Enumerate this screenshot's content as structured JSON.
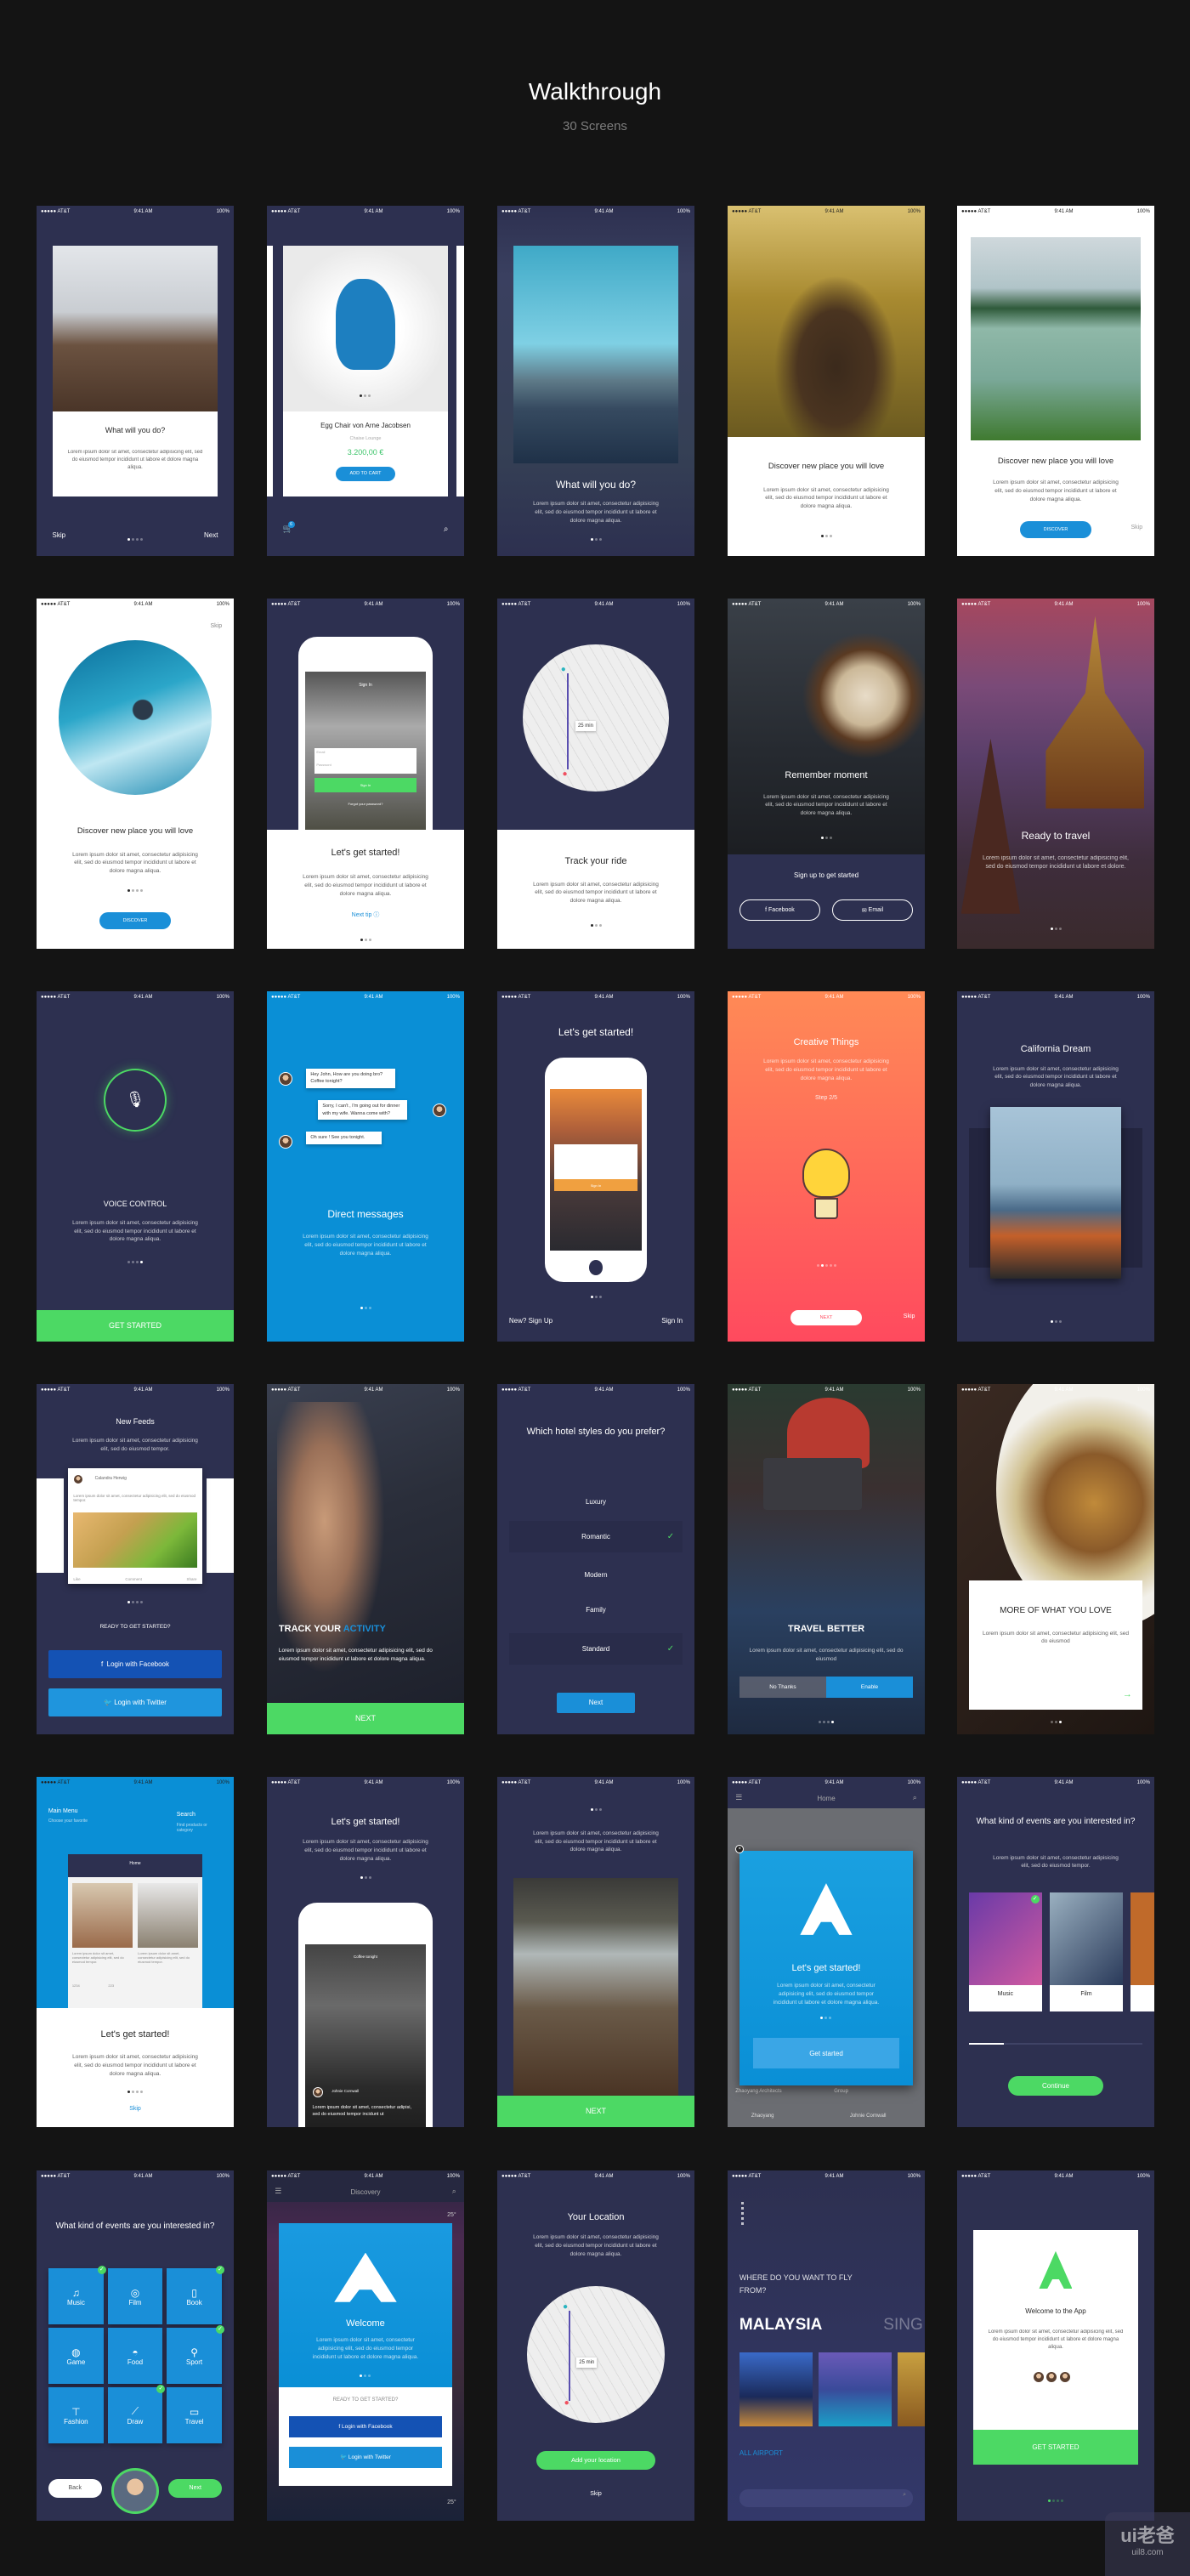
{
  "header": {
    "title": "Walkthrough",
    "subtitle": "30 Screens"
  },
  "status": {
    "carrier": "●●●●● AT&T",
    "time": "9:41 AM",
    "battery": "100%"
  },
  "lorem": {
    "long": "Lorem ipsum dolor sit amet, consectetur adipisicing elit, sed do eiusmod tempor incididunt ut labore et dolore magna aliqua.",
    "short": "Lorem ipsum dolor sit amet, consectetur adipisicing elit, sed do eiusmod tempor.",
    "travel": "Lorem ipsum dolor sit amet, consectetur adipisicing elit, sed do eiusmod tempor incididunt ut labore et dolore.",
    "mid": "Lorem ipsum dolor sit amet, consectetur adipisicing elit, sed do eiusmod"
  },
  "colors": {
    "navy": "#2d3050",
    "blue": "#1a8fd8",
    "green": "#4cd964",
    "facebook": "#1452b4",
    "twitter": "#1f95dd",
    "orange": "#ff8a56",
    "pink": "#ff4a5e"
  },
  "s1": {
    "title": "What will you do?",
    "skip": "Skip",
    "next": "Next"
  },
  "s2": {
    "title": "Egg Chair von Arne Jacobsen",
    "subtitle": "Chaise Lounge",
    "price": "3.200,00 €",
    "button": "ADD TO CART",
    "cart_badge": "6"
  },
  "s3": {
    "title": "What will you do?"
  },
  "s4": {
    "title": "Discover new place you will love"
  },
  "s5": {
    "title": "Discover new place you will love",
    "button": "DISCOVER",
    "skip": "Skip"
  },
  "s6": {
    "skip": "Skip",
    "title": "Discover new place you will love",
    "button": "DISCOVER"
  },
  "s7": {
    "title": "Let's get started!",
    "next_tip": "Next tip ⓘ",
    "mock_header": "Sign In",
    "email": "Email",
    "password": "Password",
    "signin": "Sign In",
    "forgot": "Forgot your password?"
  },
  "s8": {
    "title": "Track your ride",
    "eta": "25 min"
  },
  "s9": {
    "title": "Remember moment",
    "signup": "Sign up to get started",
    "facebook": "Facebook",
    "email": "Email"
  },
  "s10": {
    "title": "Ready to travel"
  },
  "s11": {
    "title": "VOICE CONTROL",
    "button": "GET STARTED"
  },
  "s12": {
    "title": "Direct messages",
    "msg1": "Hey John, How are you doing bro? Coffee tonight?",
    "msg2": "Sorry, I can't , I'm going out for dinner with my wife. Wanna come with?",
    "msg3": "Oh sure ! See you tonight."
  },
  "s13": {
    "title": "Let's get started!",
    "signup": "New? Sign Up",
    "signin": "Sign In",
    "mock_button": "Sign In"
  },
  "s14": {
    "title": "Creative Things",
    "step": "Step 2/5",
    "button": "NEXT",
    "skip": "Skip"
  },
  "s15": {
    "title": "California Dream"
  },
  "s16": {
    "title": "New Feeds",
    "feed_user": "Calandra Herwig",
    "like": "Like",
    "comment": "Comment",
    "share": "Share",
    "ready": "READY TO GET STARTED?",
    "facebook": "Login with Facebook",
    "twitter": "Login with Twitter"
  },
  "s17": {
    "title_a": "TRACK YOUR ",
    "title_b": "ACTIVITY",
    "button": "NEXT"
  },
  "s18": {
    "title": "Which hotel styles do you prefer?",
    "options": [
      {
        "label": "Luxury",
        "selected": false
      },
      {
        "label": "Romantic",
        "selected": true
      },
      {
        "label": "Modern",
        "selected": false
      },
      {
        "label": "Family",
        "selected": false
      },
      {
        "label": "Standard",
        "selected": true
      }
    ],
    "check": "✓",
    "button": "Next"
  },
  "s19": {
    "title": "TRAVEL BETTER",
    "no": "No Thanks",
    "yes": "Enable"
  },
  "s20": {
    "title": "MORE OF WHAT YOU LOVE",
    "arrow": "→"
  },
  "s21": {
    "menu_title": "Main Menu",
    "menu_sub": "Choose your favorite",
    "search_title": "Search",
    "search_sub": "Find products or category",
    "mock_header": "Home",
    "likes": "1234",
    "comments": "223",
    "title": "Let's get started!",
    "skip": "Skip"
  },
  "s22": {
    "title": "Let's get started!",
    "mock_header": "Coffee tonight",
    "user": "Johnie Cornwall",
    "post": "Lorem ipsum dolor sit amet, consectetur adipisi, sed do eiusmod tempor incidunt ut"
  },
  "s23": {
    "button": "NEXT"
  },
  "s24": {
    "header": "Home",
    "title": "Let's get started!",
    "button": "Get started",
    "bg_item1": "Zhaoyang Architects",
    "bg_item2": "Group",
    "bg_user1": "Zhaoyang",
    "bg_user2": "Johnie Cornwall"
  },
  "s25": {
    "title": "What kind of events are you interested in?",
    "cat1": "Music",
    "cat2": "Film",
    "button": "Continue",
    "progress": 0.2
  },
  "s26": {
    "title": "What kind of events are you interested in?",
    "tiles": [
      {
        "label": "Music",
        "icon": "♫",
        "checked": true
      },
      {
        "label": "Film",
        "icon": "◎",
        "checked": false
      },
      {
        "label": "Book",
        "icon": "▯",
        "checked": true
      },
      {
        "label": "Game",
        "icon": "◍",
        "checked": false
      },
      {
        "label": "Food",
        "icon": "◓",
        "checked": false
      },
      {
        "label": "Sport",
        "icon": "⚲",
        "checked": true
      },
      {
        "label": "Fashion",
        "icon": "⊤",
        "checked": false
      },
      {
        "label": "Draw",
        "icon": "⟋",
        "checked": true
      },
      {
        "label": "Travel",
        "icon": "▭",
        "checked": false
      }
    ],
    "check": "✓",
    "back": "Back",
    "next": "Next"
  },
  "s27": {
    "header": "Discovery",
    "temp": "25°",
    "title": "Welcome",
    "ready": "READY TO GET STARTED?",
    "facebook": "Login with Facebook",
    "twitter": "Login with Twitter"
  },
  "s28": {
    "title": "Your Location",
    "eta": "25 min",
    "button": "Add your location",
    "skip": "Skip"
  },
  "s29": {
    "question": "WHERE DO YOU WANT TO FLY FROM?",
    "country": "MALAYSIA",
    "next_country": "SING",
    "all": "ALL AIRPORT"
  },
  "s30": {
    "title": "Welcome to the App",
    "button": "GET STARTED"
  },
  "watermark": {
    "logo": "ui老爸",
    "site": "uil8.com"
  }
}
